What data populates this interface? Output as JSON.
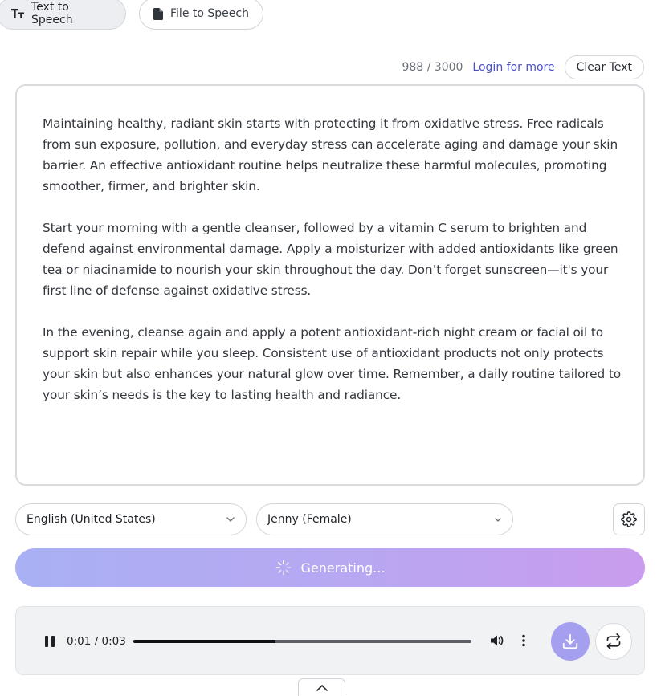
{
  "tabs": [
    {
      "label": "Text to Speech",
      "active": true,
      "icon": "text-format-icon"
    },
    {
      "label": "File to Speech",
      "active": false,
      "icon": "file-icon"
    }
  ],
  "editor": {
    "char_count": "988 / 3000",
    "login_link": "Login for more",
    "clear_label": "Clear Text",
    "paragraphs": [
      "Maintaining healthy, radiant skin starts with protecting it from oxidative stress. Free radicals from sun exposure, pollution, and everyday stress can accelerate aging and damage your skin barrier. An effective antioxidant routine helps neutralize these harmful molecules, promoting smoother, firmer, and brighter skin.",
      "Start your morning with a gentle cleanser, followed by a vitamin C serum to brighten and defend against environmental damage. Apply a moisturizer with added antioxidants like green tea or niacinamide to nourish your skin throughout the day. Don’t forget sunscreen—it's your first line of defense against oxidative stress.",
      "In the evening, cleanse again and apply a potent antioxidant-rich night cream or facial oil to support skin repair while you sleep. Consistent use of antioxidant products not only protects your skin but also enhances your natural glow over time. Remember, a daily routine tailored to your skin’s needs is the key to lasting health and radiance."
    ]
  },
  "controls": {
    "language": "English (United States)",
    "voice": "Jenny (Female)",
    "generate_label": "Generating..."
  },
  "player": {
    "current_time": "0:01",
    "separator": "/",
    "duration": "0:03",
    "progress": 0.42
  },
  "colors": {
    "accent": "#4a4fc4",
    "gradient_start": "#a9b0f4",
    "gradient_end": "#c99cee",
    "download_bg": "#a4a0ef"
  }
}
